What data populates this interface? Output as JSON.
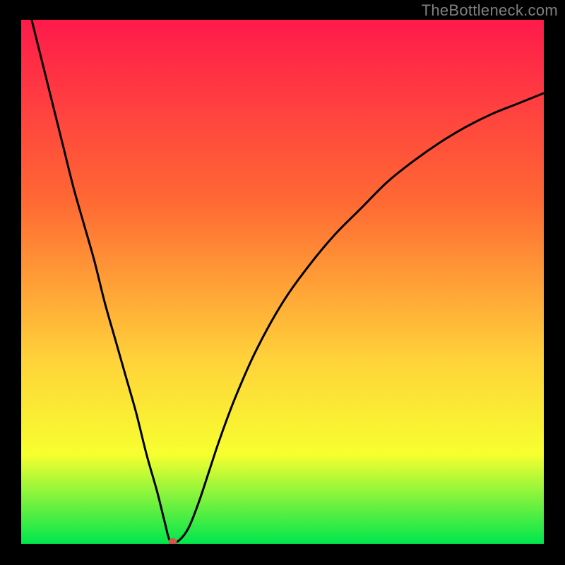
{
  "watermark": "TheBottleneck.com",
  "chart_data": {
    "type": "line",
    "title": "",
    "xlabel": "",
    "ylabel": "",
    "xlim": [
      0,
      100
    ],
    "ylim": [
      0,
      100
    ],
    "grid": false,
    "legend": false,
    "background_gradient": [
      "#ff1a4b",
      "#ff6a33",
      "#ffd33a",
      "#f7ff2f",
      "#00e64d"
    ],
    "series": [
      {
        "name": "bottleneck-curve",
        "x": [
          2,
          4,
          6,
          8,
          10,
          12,
          14,
          16,
          18,
          20,
          22,
          24,
          26,
          27.5,
          28.5,
          30,
          32,
          34,
          36,
          38,
          41,
          45,
          50,
          55,
          60,
          65,
          70,
          75,
          80,
          85,
          90,
          95,
          100
        ],
        "values": [
          100,
          92,
          84,
          76,
          68,
          61,
          54,
          46,
          39,
          32,
          25,
          17,
          10,
          4,
          0.5,
          0.5,
          3,
          8,
          14,
          20,
          28,
          37,
          46,
          53,
          59,
          64,
          69,
          73,
          76.5,
          79.5,
          82,
          84,
          86
        ]
      }
    ],
    "markers": [
      {
        "name": "bottleneck-point",
        "x": 29,
        "y": 0.4,
        "color": "#d9534f",
        "rx": 6,
        "ry": 5
      }
    ]
  }
}
